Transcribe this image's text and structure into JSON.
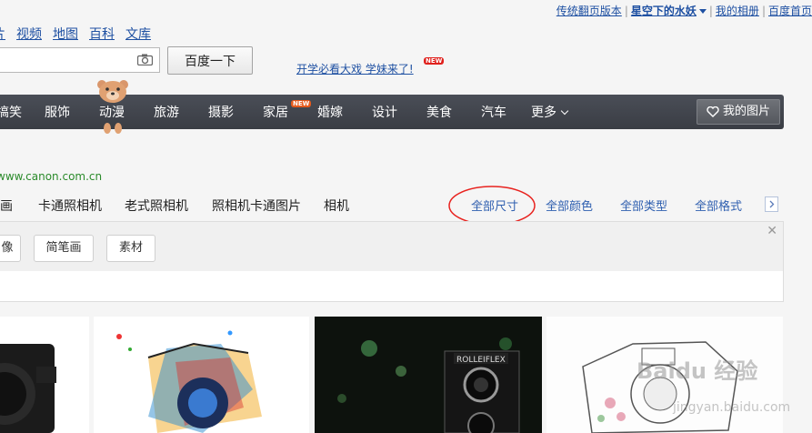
{
  "top_links": {
    "classic_page": "传统翻页版本",
    "username": "星空下的水妖",
    "my_album": "我的相册",
    "baidu_home": "百度首页"
  },
  "product_links": [
    "片",
    "视频",
    "地图",
    "百科",
    "文库"
  ],
  "search": {
    "value": "",
    "button_label": "百度一下",
    "camera_icon": "camera-icon"
  },
  "promo": {
    "text": "开学必看大戏 学妹来了!",
    "badge": "NEW"
  },
  "nav": {
    "items": [
      "搞笑",
      "服饰",
      "动漫",
      "旅游",
      "摄影",
      "家居",
      "婚嫁",
      "设计",
      "美食",
      "汽车",
      "更多"
    ],
    "new_badge": "NEW",
    "my_pics": "我的图片"
  },
  "source_url": "www.canon.com.cn",
  "related_tags": [
    "笔画",
    "卡通照相机",
    "老式照相机",
    "照相机卡通图片",
    "相机"
  ],
  "filters": [
    "全部尺寸",
    "全部颜色",
    "全部类型",
    "全部格式"
  ],
  "sub_tags": [
    "像",
    "简笔画",
    "素材"
  ],
  "watermark": {
    "brand": "Baidu 经验",
    "url": "jingyan.baidu.com"
  },
  "colors": {
    "link": "#1e50a2",
    "nav_bg": "#3f434a",
    "annotation": "#e8231f",
    "source_green": "#2a8a2a"
  }
}
